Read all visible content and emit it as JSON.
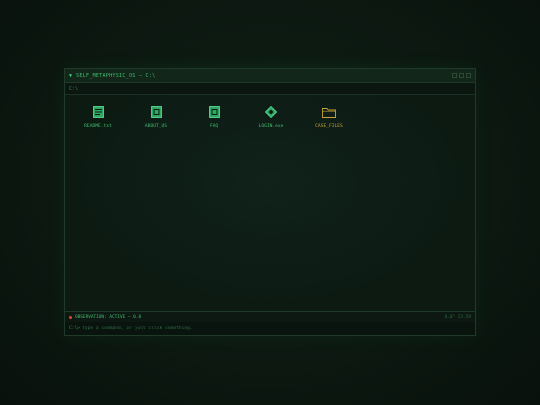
{
  "window": {
    "title": "SELF_METAPHYSIC_OS — C:\\",
    "path": "C:\\"
  },
  "desktop": {
    "icons": [
      {
        "label": "README.txt",
        "icon": "document-icon"
      },
      {
        "label": "ABOUT_US",
        "icon": "file-icon"
      },
      {
        "label": "FAQ",
        "icon": "file-icon"
      },
      {
        "label": "LOGIN.exe",
        "icon": "diamond-icon"
      },
      {
        "label": "CASE_FILES",
        "icon": "folder-icon"
      }
    ]
  },
  "status": {
    "text": "OBSERVATION: ACTIVE — 0.0",
    "right": "0.0° 23.59"
  },
  "command": {
    "prompt": "C:\\>",
    "placeholder": "type a command, or just click something."
  },
  "colors": {
    "accent": "#3fbf6f",
    "folder": "#c9a23a",
    "alert": "#d9482e",
    "background": "#0e1c14"
  }
}
